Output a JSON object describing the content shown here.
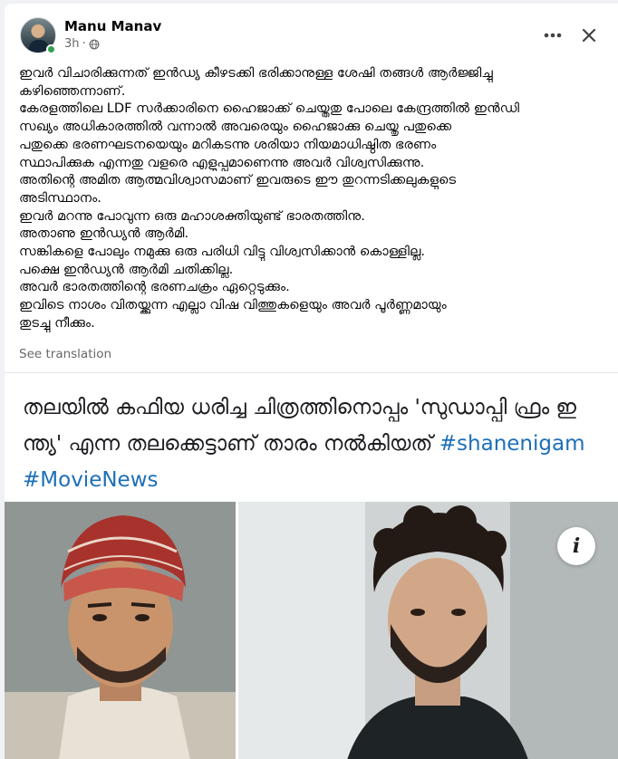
{
  "post": {
    "author": "Manu Manav",
    "time": "3h",
    "separator": "·",
    "more_icon": "more-horizontal-icon",
    "close_icon": "close-icon",
    "privacy_icon": "globe-icon",
    "lines": [
      "ഇവർ വിചാരിക്കുന്നത് ഇൻഡ്യ കീഴടക്കി ഭരിക്കാനുള്ള ശേഷി തങ്ങൾ ആർജ്ജിച്ചു",
      "കഴിഞ്ഞെന്നാണ്.",
      "കേരളത്തിലെ LDF സർക്കാരിനെ ഹൈജാക്ക് ചെയ്തതു പോലെ കേന്ദ്രത്തിൽ ഇൻഡി",
      "സഖ്യം അധികാരത്തിൽ വന്നാൽ അവരെയും ഹൈജാക്കു ചെയ്തു പതുക്കെ",
      "പതുക്കെ ഭരണഘടനയെയും മറികടന്നു ശരിയാ നിയമാധിഷ്ഠിത ഭരണം",
      "സ്ഥാപിക്കുക എന്നതു വളരെ എളുപ്പമാണെന്നു അവർ വിശ്വസിക്കുന്നു.",
      "അതിന്റെ അമിത ആത്മവിശ്വാസമാണ് ഇവരുടെ ഈ തുറന്നടിക്കലുകളുടെ",
      "അടിസ്ഥാനം.",
      "ഇവർ മറന്നു പോവുന്ന ഒരു മഹാശക്തിയുണ്ട് ഭാരതത്തിനു.",
      "അതാണു ഇൻഡ്യൻ ആർമി.",
      "സങ്കികളെ പോലും നമുക്കു ഒരു പരിധി വിട്ടു വിശ്വസിക്കാൻ കൊള്ളില്ല.",
      "പക്ഷെ ഇൻഡ്യൻ ആർമി ചതിക്കില്ല.",
      "അവർ ഭാരതത്തിന്റെ ഭരണചക്രം ഏറ്റെടുക്കും.",
      "ഇവിടെ നാശം വിതയ്ക്കുന്ന എല്ലാ വിഷ വിത്തുകളെയും അവർ പൂർണ്ണമായും",
      "തുടച്ചു നീക്കും."
    ],
    "see_translation": "See translation"
  },
  "link_preview": {
    "headline_line1": "തലയിൽ കഫിയ ധരിച്ച ചിത്രത്തിനൊപ്പം 'സുഡാപ്പി ഫ്രം ഇ",
    "headline_line2_text": "ന്ത്യ' എന്ന തലക്കെട്ടാണ് താരം നൽകിയത് ",
    "hashtag1": "#shanenigam",
    "hashtag2": "#MovieNews",
    "info_icon": "info-icon",
    "info_glyph": "i",
    "left_photo": "man-in-red-keffiyeh-photo",
    "right_photo": "man-with-curly-hair-beard-photo"
  },
  "colors": {
    "accent_link": "#1d6fb8",
    "online": "#31a24c",
    "secondary_text": "#65676b"
  }
}
